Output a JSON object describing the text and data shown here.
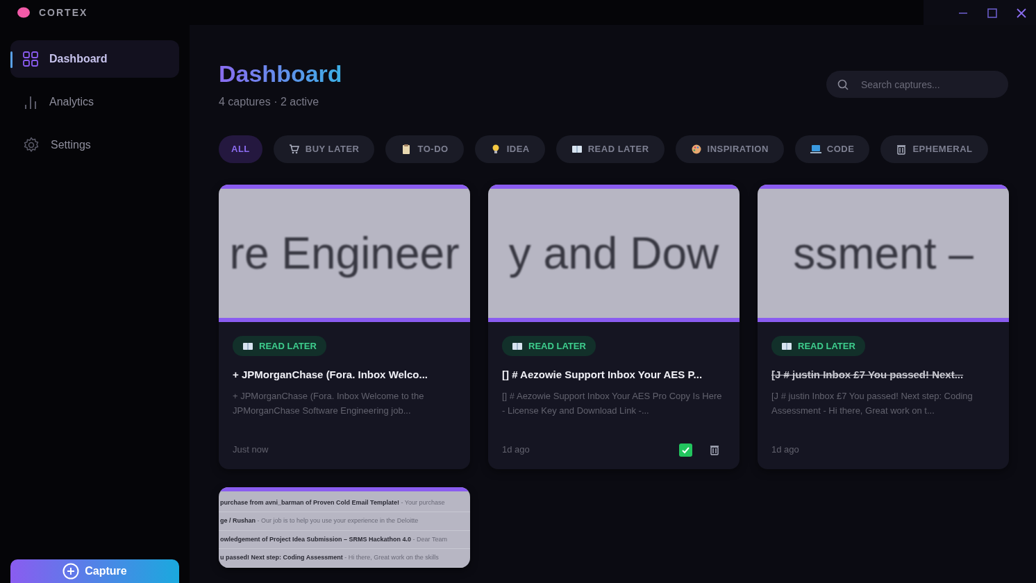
{
  "app": {
    "title": "CORTEX"
  },
  "sidebar": {
    "items": [
      {
        "label": "Dashboard",
        "kind": "grid",
        "selected": true
      },
      {
        "label": "Analytics",
        "kind": "chart",
        "selected": false
      },
      {
        "label": "Settings",
        "kind": "gear",
        "selected": false
      }
    ],
    "capture_button": "Capture"
  },
  "header": {
    "title": "Dashboard",
    "subtitle": "4 captures · 2 active"
  },
  "search": {
    "placeholder": "Search captures..."
  },
  "filters": [
    {
      "label": "ALL",
      "kind": "none",
      "selected": true
    },
    {
      "label": "BUY LATER",
      "kind": "cart",
      "selected": false
    },
    {
      "label": "TO-DO",
      "kind": "clipboard",
      "selected": false
    },
    {
      "label": "IDEA",
      "kind": "bulb",
      "selected": false
    },
    {
      "label": "READ LATER",
      "kind": "book",
      "selected": false
    },
    {
      "label": "INSPIRATION",
      "kind": "palette",
      "selected": false
    },
    {
      "label": "CODE",
      "kind": "laptop",
      "selected": false
    },
    {
      "label": "EPHEMERAL",
      "kind": "bin",
      "selected": false
    }
  ],
  "cards": [
    {
      "thumbnail": {
        "kind": "large",
        "lines": [
          "re Engineer"
        ]
      },
      "tag": "READ LATER",
      "title": "+ JPMorganChase (Fora. Inbox Welco...",
      "preview": "+ JPMorganChase (Fora. Inbox Welcome to the JPMorganChase Software Engineering job...",
      "time": "Just now",
      "done": false
    },
    {
      "thumbnail": {
        "kind": "large",
        "lines": [
          "y and Dow"
        ]
      },
      "tag": "READ LATER",
      "title": "[] # Aezowie Support Inbox Your AES P...",
      "preview": "[] # Aezowie Support Inbox Your AES Pro Copy Is Here - License Key and Download Link -...",
      "time": "1d ago",
      "done": false,
      "actions": {
        "checked": true
      }
    },
    {
      "thumbnail": {
        "kind": "large",
        "lines": [
          "ssment –"
        ]
      },
      "tag": "READ LATER",
      "title": "[J # justin Inbox £7 You passed! Next...",
      "preview": "[J # justin Inbox £7 You passed! Next step: Coding Assessment - Hi there, Great work on t...",
      "time": "1d ago",
      "done": true
    },
    {
      "thumbnail": {
        "kind": "list",
        "lines": [
          "**purchase from avni_barman of Proven Cold Email Template!** - Your purchase",
          "**ge / Rushan** - Our job is to help you use your experience in the Deloitte",
          "**owledgement of Project Idea Submission – SRMS Hackathon 4.0** - Dear Team",
          "**u passed! Next step: Coding Assessment** - Hi there, Great work on the skills"
        ]
      }
    }
  ]
}
